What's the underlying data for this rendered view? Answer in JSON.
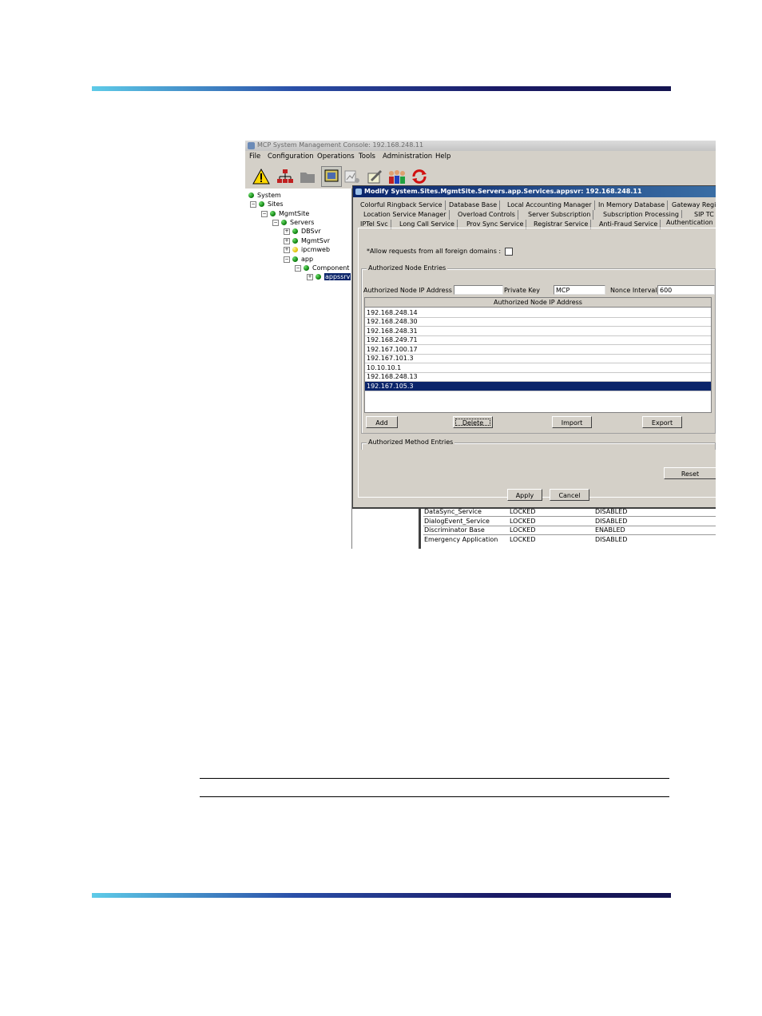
{
  "app": {
    "window_title": "MCP System Management Console: 192.168.248.11",
    "menu": [
      "File",
      "Configuration",
      "Operations",
      "Tools",
      "Administration",
      "Help"
    ],
    "toolbar_icons": [
      "warning-icon",
      "network-topology-icon",
      "folder-icon",
      "monitor-icon",
      "chart-icon",
      "edit-icon",
      "users-icon",
      "refresh-icon"
    ]
  },
  "tree": {
    "system": "System",
    "sites": "Sites",
    "mgmtsite": "MgmtSite",
    "servers": "Servers",
    "dbsvr": "DBSvr",
    "mgmtsvr": "MgmtSvr",
    "ipcmweb": "ipcmweb",
    "app": "app",
    "component": "Component",
    "appssrv": "appssrv"
  },
  "background_table": {
    "rows": [
      [
        "DataSync_Service",
        "LOCKED",
        "DISABLED"
      ],
      [
        "DialogEvent_Service",
        "LOCKED",
        "DISABLED"
      ],
      [
        "Discriminator Base",
        "LOCKED",
        "ENABLED"
      ],
      [
        "Emergency Application",
        "LOCKED",
        "DISABLED"
      ]
    ]
  },
  "dialog": {
    "title": "Modify System.Sites.MgmtSite.Servers.app.Services.appsvr: 192.168.248.11",
    "tabs_row1": [
      "Colorful Ringback Service",
      "Database Base",
      "Local Accounting Manager",
      "In Memory Database",
      "Gateway Regi"
    ],
    "tabs_row2": [
      "Location Service Manager",
      "Overload Controls",
      "Server Subscription",
      "Subscription Processing",
      "SIP TC"
    ],
    "tabs_row3": [
      "IPTel Svc",
      "Long Call Service",
      "Prov Sync Service",
      "Registrar Service",
      "Anti-Fraud Service",
      "Authentication"
    ],
    "active_tab": "Authentication",
    "foreign_domains_label": "*Allow requests from all foreign domains :",
    "foreign_domains_checked": false,
    "node_group_title": "Authorized Node Entries",
    "ip_label": "Authorized Node IP Address",
    "ip_value": "",
    "key_label": "Private Key",
    "key_value": "MCP",
    "nonce_label": "Nonce Interval",
    "nonce_value": "600",
    "list_header": "Authorized Node IP Address",
    "ip_list": [
      "192.168.248.14",
      "192.168.248.30",
      "192.168.248.31",
      "192.168.249.71",
      "192.167.100.17",
      "192.167.101.3",
      "10.10.10.1",
      "192.168.248.13",
      "192.167.105.3"
    ],
    "selected_ip": "192.167.105.3",
    "add_btn": "Add",
    "delete_btn": "Delete",
    "import_btn": "Import",
    "export_btn": "Export",
    "method_group_title": "Authorized Method Entries",
    "reset_btn": "Reset",
    "apply_btn": "Apply",
    "cancel_btn": "Cancel"
  }
}
